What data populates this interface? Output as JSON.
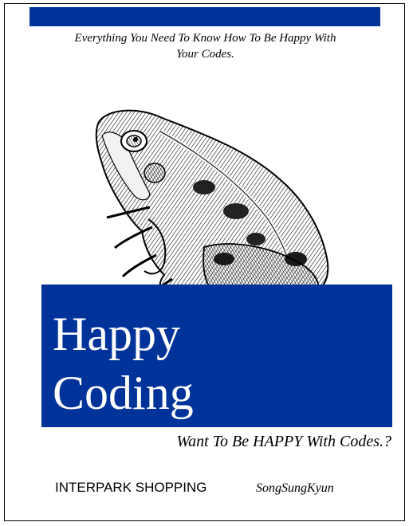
{
  "cover": {
    "tagline_line1": "Everything You Need To Know How To Be Happy With",
    "tagline_line2": "Your Codes.",
    "title_line1": "Happy",
    "title_line2": "Coding",
    "subtitle": "Want To Be HAPPY With Codes.?",
    "publisher": "INTERPARK SHOPPING",
    "author": "SongSungKyun",
    "illustration": "frog-icon"
  },
  "colors": {
    "accent": "#003399",
    "text": "#000000",
    "title_text": "#ffffff",
    "background": "#ffffff"
  }
}
